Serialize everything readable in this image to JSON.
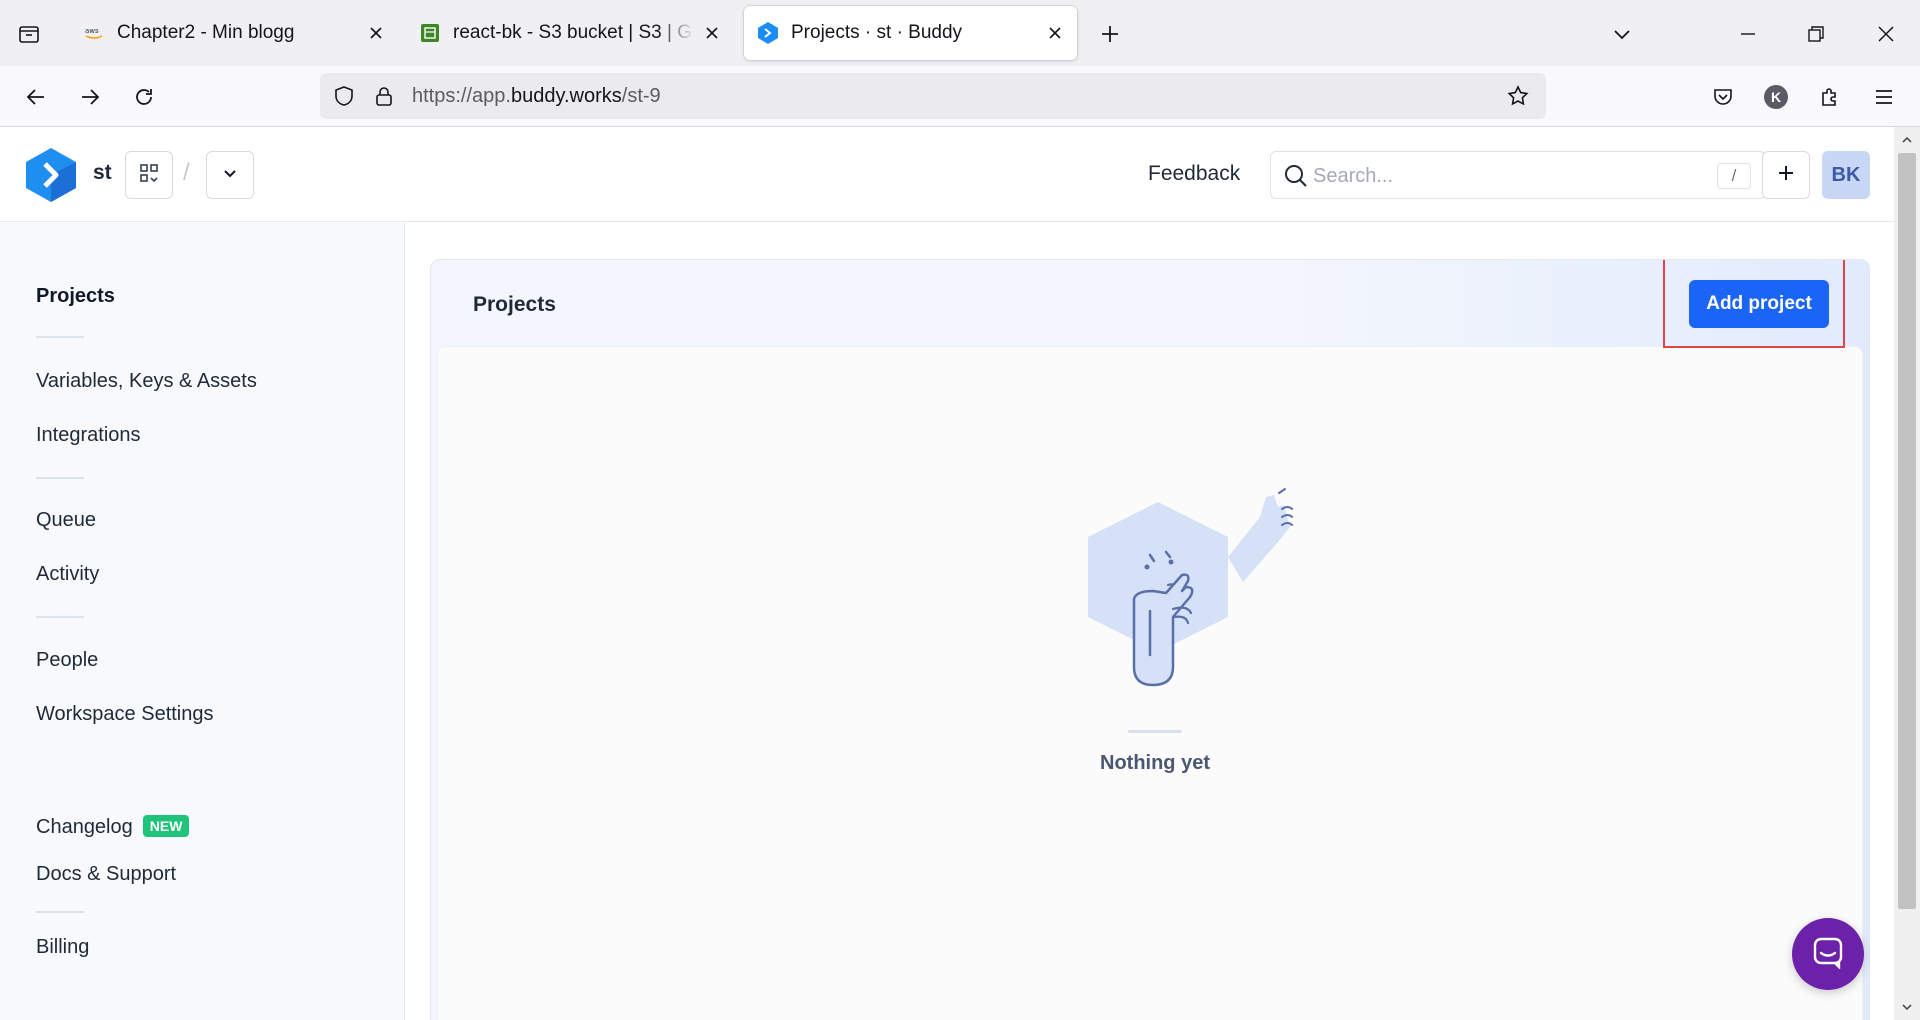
{
  "browser": {
    "tabs": [
      {
        "title": "Chapter2 - Min blogg",
        "favicon": "aws-favicon-icon",
        "active": false
      },
      {
        "title": "react-bk - S3 bucket | S3 | Global",
        "favicon": "s3-favicon-icon",
        "active": false
      },
      {
        "title": "Projects · st · Buddy",
        "favicon": "buddy-favicon-icon",
        "active": true
      }
    ],
    "url": {
      "scheme": "https://app.",
      "host": "buddy.works",
      "path": "/st-9"
    },
    "profile_initial": "K"
  },
  "header": {
    "workspace_name": "st",
    "breadcrumb_separator": "/",
    "feedback_label": "Feedback",
    "search_placeholder": "Search...",
    "search_shortcut": "/",
    "avatar_initials": "BK"
  },
  "sidebar": {
    "items": [
      {
        "label": "Projects",
        "active": true
      },
      {
        "label": "Variables, Keys & Assets"
      },
      {
        "label": "Integrations"
      },
      {
        "label": "Queue"
      },
      {
        "label": "Activity"
      },
      {
        "label": "People"
      },
      {
        "label": "Workspace Settings"
      },
      {
        "label": "Changelog",
        "badge": "NEW"
      },
      {
        "label": "Docs & Support"
      },
      {
        "label": "Billing"
      }
    ]
  },
  "main": {
    "title": "Projects",
    "add_button_label": "Add project",
    "empty_state_text": "Nothing yet"
  },
  "colors": {
    "accent": "#1a65f5",
    "highlight_box": "#e04448",
    "badge_new": "#1fc47a",
    "chat_launcher": "#6b21a8"
  }
}
